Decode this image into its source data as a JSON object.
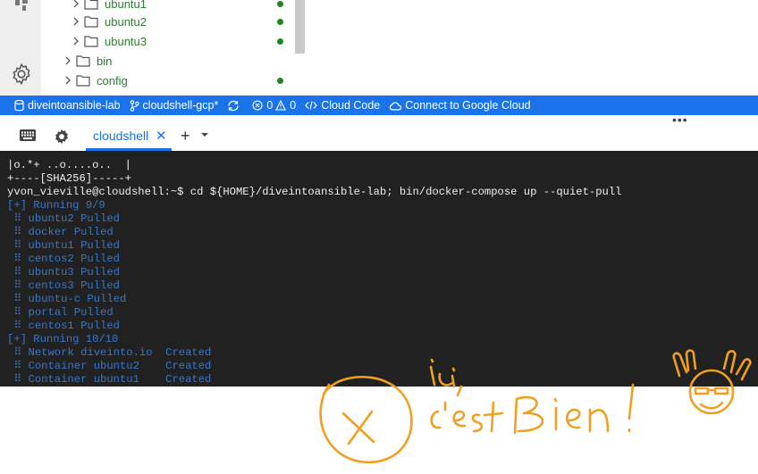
{
  "explorer": {
    "items": [
      {
        "label": "ubuntu1",
        "style": "nested"
      },
      {
        "label": "ubuntu2",
        "style": "nested"
      },
      {
        "label": "ubuntu3",
        "style": "nested"
      },
      {
        "label": "bin",
        "style": "top"
      },
      {
        "label": "config",
        "style": "top"
      }
    ]
  },
  "statusbar": {
    "project": "diveintoansible-lab",
    "branch": "cloudshell-gcp*",
    "errors": "0",
    "warnings": "0",
    "cloud_code": "Cloud Code",
    "connect": "Connect to Google Cloud"
  },
  "panel": {
    "more": "•••",
    "tab_label": "cloudshell",
    "tab_close": "✕",
    "add": "+"
  },
  "terminal": {
    "lines": [
      {
        "text": "|o.*+ ..o....o..  |",
        "color": "white"
      },
      {
        "text": "+----[SHA256]-----+",
        "color": "white"
      },
      {
        "text": "yvon_vieville@cloudshell:~$ cd ${HOME}/diveintoansible-lab; bin/docker-compose up --quiet-pull",
        "color": "white"
      },
      {
        "text": "[+] Running 9/9",
        "color": "blue"
      },
      {
        "text": " ⠿ ubuntu2 Pulled",
        "color": "blue"
      },
      {
        "text": " ⠿ docker Pulled",
        "color": "blue"
      },
      {
        "text": " ⠿ ubuntu1 Pulled",
        "color": "blue"
      },
      {
        "text": " ⠿ centos2 Pulled",
        "color": "blue"
      },
      {
        "text": " ⠿ ubuntu3 Pulled",
        "color": "blue"
      },
      {
        "text": " ⠿ centos3 Pulled",
        "color": "blue"
      },
      {
        "text": " ⠿ ubuntu-c Pulled",
        "color": "blue"
      },
      {
        "text": " ⠿ portal Pulled",
        "color": "blue"
      },
      {
        "text": " ⠿ centos1 Pulled",
        "color": "blue"
      },
      {
        "text": "[+] Running 10/10",
        "color": "blue"
      },
      {
        "text": " ⠿ Network diveinto.io  Created",
        "color": "blue"
      },
      {
        "text": " ⠿ Container ubuntu2    Created",
        "color": "blue"
      },
      {
        "text": " ⠿ Container ubuntu1    Created",
        "color": "blue"
      }
    ]
  },
  "colors": {
    "statusbar": "#1a73e8",
    "terminal_bg": "#212121",
    "terminal_blue": "#3a77c8",
    "annotation": "#f0a020",
    "tree_dot": "#1b8a1b"
  },
  "icons": [
    "logo-icon",
    "settings-gear-icon",
    "chevron-right-icon",
    "folder-icon",
    "database-icon",
    "branch-icon",
    "sync-icon",
    "error-icon",
    "warning-icon",
    "code-icon",
    "cloud-icon",
    "keyboard-icon",
    "gear-icon",
    "plus-icon",
    "caret-down-icon"
  ],
  "annotation": {
    "line1": "ici,",
    "line2": "c'est Bien!"
  }
}
